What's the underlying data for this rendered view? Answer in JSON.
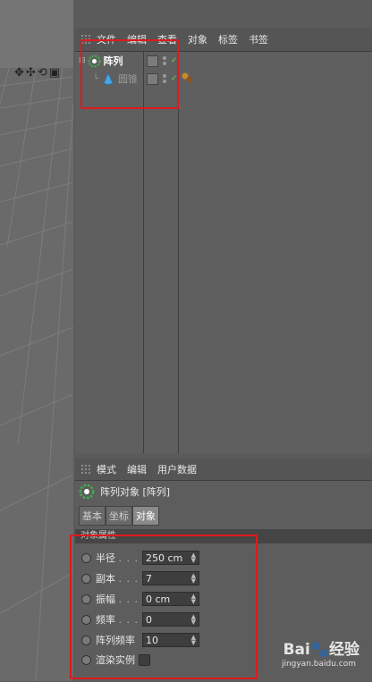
{
  "object_manager": {
    "menu": [
      "文件",
      "编辑",
      "查看",
      "对象",
      "标签",
      "书签"
    ],
    "objects": [
      {
        "name": "阵列",
        "icon": "array-icon"
      },
      {
        "name": "圆锥",
        "icon": "cone-icon"
      }
    ]
  },
  "attributes_manager": {
    "menu": [
      "模式",
      "编辑",
      "用户数据"
    ],
    "object_title": "阵列对象 [阵列]",
    "tabs": [
      "基本",
      "坐标",
      "对象"
    ],
    "active_tab": "对象",
    "section_header": "对象属性",
    "properties": [
      {
        "label": "半径",
        "dots": ". . .",
        "value": "250 cm"
      },
      {
        "label": "副本",
        "dots": ". . .",
        "value": "7"
      },
      {
        "label": "振幅",
        "dots": ". . .",
        "value": "0 cm"
      },
      {
        "label": "频率",
        "dots": ". . .",
        "value": "0"
      },
      {
        "label": "阵列频率",
        "dots": "",
        "value": "10"
      }
    ],
    "checkbox_property": {
      "label": "渲染实例",
      "checked": false
    }
  },
  "watermark": {
    "brand": "Bai🐾经验",
    "url": "jingyan.baidu.com"
  },
  "colors": {
    "highlight_box": "#e0191c",
    "check": "#7fd04a"
  }
}
